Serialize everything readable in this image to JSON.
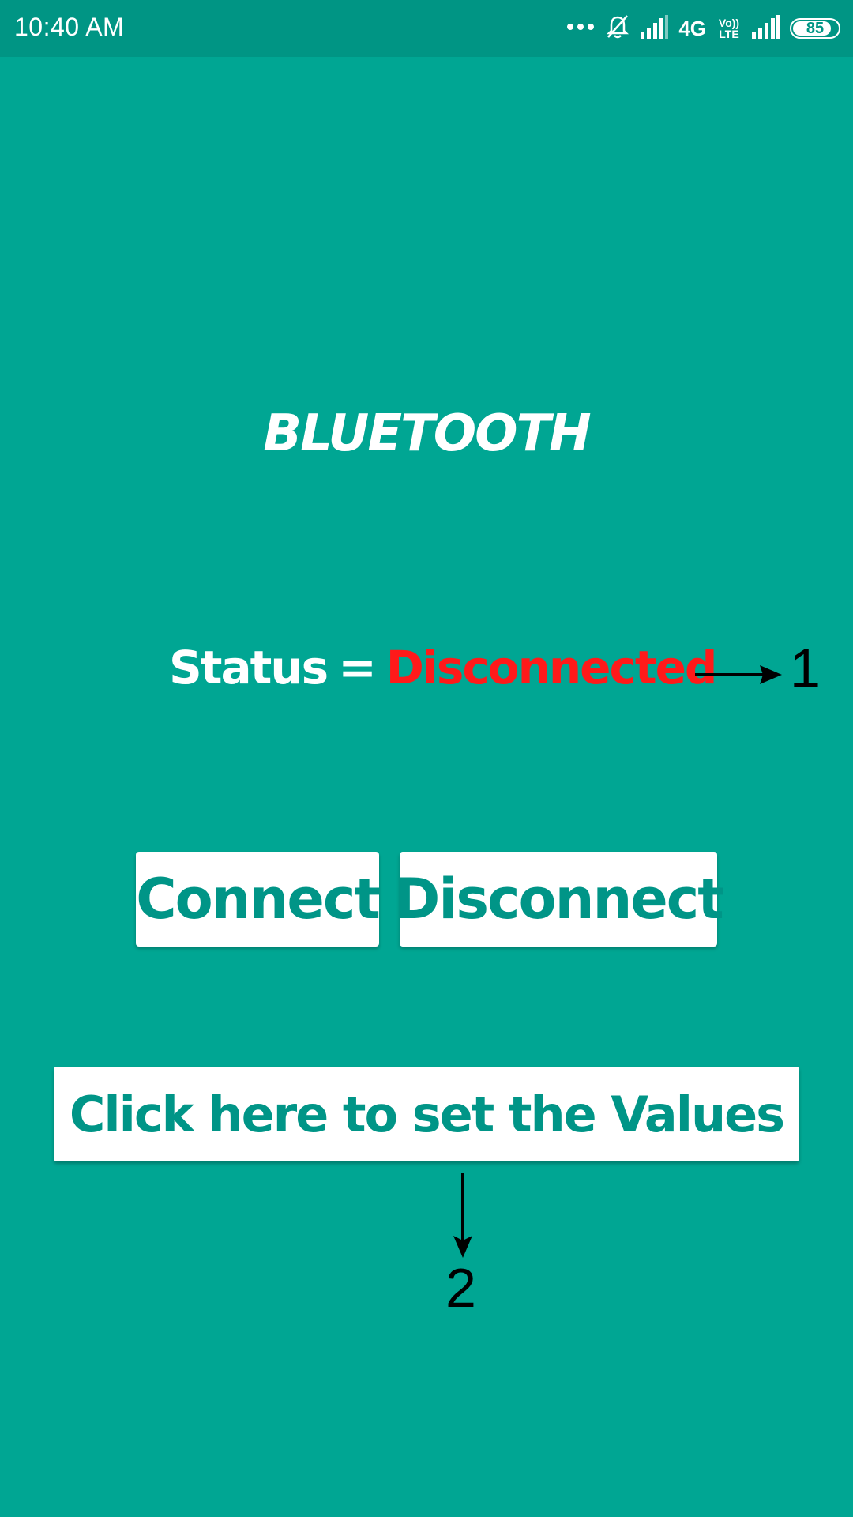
{
  "status_bar": {
    "time": "10:40 AM",
    "network": "4G",
    "volte_top": "Vo))",
    "volte_bottom": "LTE",
    "battery_level": "85",
    "battery_fraction": 0.85
  },
  "main": {
    "title": "BLUETOOTH",
    "status_label": "Status",
    "status_equals": "=",
    "status_value": "Disconnected"
  },
  "buttons": {
    "connect_label": "Connect",
    "disconnect_label": "Disconnect",
    "set_values_label": "Click here to set the Values"
  },
  "annotations": {
    "marker_1": "1",
    "marker_2": "2"
  },
  "colors": {
    "background": "#00a693",
    "status_bar": "#009584",
    "button_text": "#009587",
    "status_disconnected": "#ff1a1a"
  },
  "icons": [
    "more-dots-icon",
    "muted-bell-icon",
    "signal-icon",
    "signal-icon-2"
  ]
}
